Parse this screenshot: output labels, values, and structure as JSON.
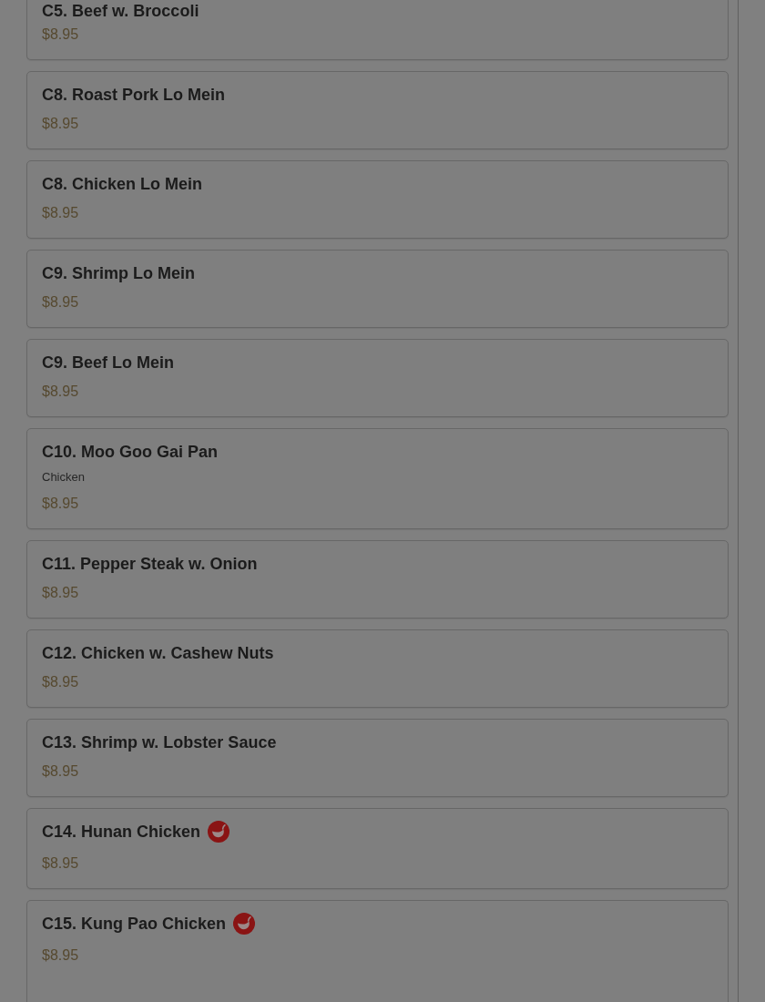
{
  "menu_items": [
    {
      "name": "C5. Beef w. Broccoli",
      "price": "$8.95",
      "spicy": false
    },
    {
      "name": "C8. Roast Pork Lo Mein",
      "price": "$8.95",
      "spicy": false
    },
    {
      "name": "C8. Chicken Lo Mein",
      "price": "$8.95",
      "spicy": false
    },
    {
      "name": "C9. Shrimp Lo Mein",
      "price": "$8.95",
      "spicy": false
    },
    {
      "name": "C9. Beef Lo Mein",
      "price": "$8.95",
      "spicy": false
    },
    {
      "name": "C10. Moo Goo Gai Pan",
      "description": "Chicken",
      "price": "$8.95",
      "spicy": false
    },
    {
      "name": "C11. Pepper Steak w. Onion",
      "price": "$8.95",
      "spicy": false
    },
    {
      "name": "C12. Chicken w. Cashew Nuts",
      "price": "$8.95",
      "spicy": false
    },
    {
      "name": "C13. Shrimp w. Lobster Sauce",
      "price": "$8.95",
      "spicy": false
    },
    {
      "name": "C14. Hunan Chicken",
      "price": "$8.95",
      "spicy": true
    },
    {
      "name": "C15. Kung Pao Chicken",
      "price": "$8.95",
      "spicy": true
    }
  ]
}
